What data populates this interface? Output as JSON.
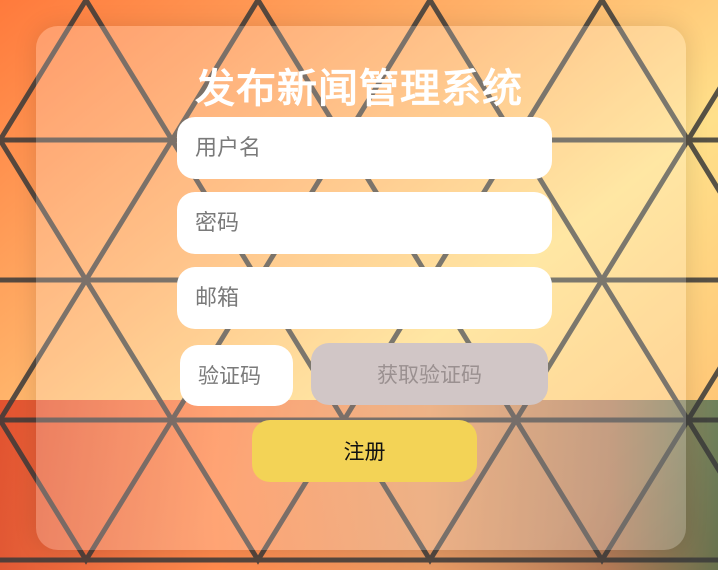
{
  "form": {
    "title": "发布新闻管理系统",
    "username_placeholder": "用户名",
    "password_placeholder": "密码",
    "email_placeholder": "邮箱",
    "code_placeholder": "验证码",
    "get_code_label": "获取验证码",
    "register_label": "注册"
  },
  "colors": {
    "register_button": "#f3d356",
    "get_code_button": "#d1c6c6",
    "title_text": "#ffffff"
  }
}
